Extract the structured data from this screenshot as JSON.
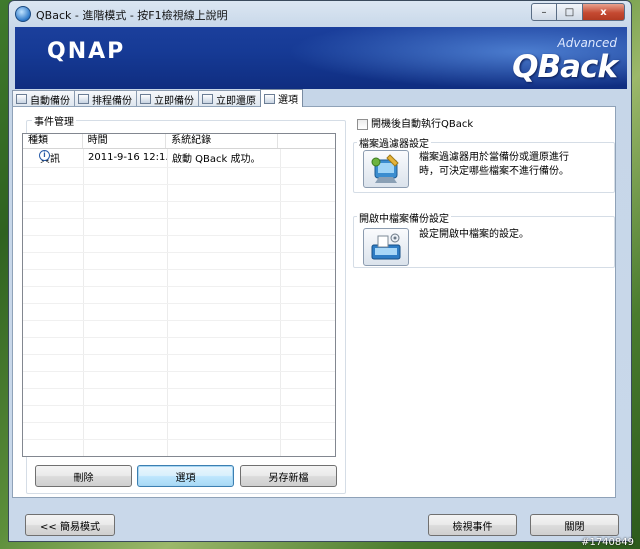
{
  "window": {
    "title": "QBack - 進階模式 - 按F1檢視線上說明",
    "minimize_label": "–",
    "maximize_label": "□",
    "close_label": "x"
  },
  "banner": {
    "brand": "QNAP",
    "product_prefix": "Advanced",
    "product": "QBack"
  },
  "tabs": [
    {
      "label": "自動備份",
      "icon": "auto-backup-icon"
    },
    {
      "label": "排程備份",
      "icon": "schedule-icon"
    },
    {
      "label": "立即備份",
      "icon": "backup-now-icon"
    },
    {
      "label": "立即還原",
      "icon": "restore-now-icon"
    },
    {
      "label": "選項",
      "icon": "options-icon",
      "active": true
    }
  ],
  "events": {
    "group_title": "事件管理",
    "columns": [
      "種類",
      "時間",
      "系統紀錄"
    ],
    "rows": [
      {
        "type": "資訊",
        "time": "2011-9-16 12:1...",
        "log": "啟動 QBack 成功。",
        "icon": "info-icon"
      }
    ],
    "buttons": {
      "delete": "刪除",
      "options": "選項",
      "save_as": "另存新檔"
    }
  },
  "options": {
    "autostart_label": "開機後自動執行QBack",
    "autostart_checked": false,
    "filter": {
      "title": "檔案過濾器設定",
      "description_line1": "檔案過濾器用於當備份或還原進行",
      "description_line2": "時，可決定哪些檔案不進行備份。"
    },
    "open_file": {
      "title": "開啟中檔案備份設定",
      "description": "設定開啟中檔案的設定。"
    }
  },
  "footer": {
    "simple_mode": "<< 簡易模式",
    "view_events": "檢視事件",
    "close": "關閉"
  },
  "watermark": "#1740849"
}
